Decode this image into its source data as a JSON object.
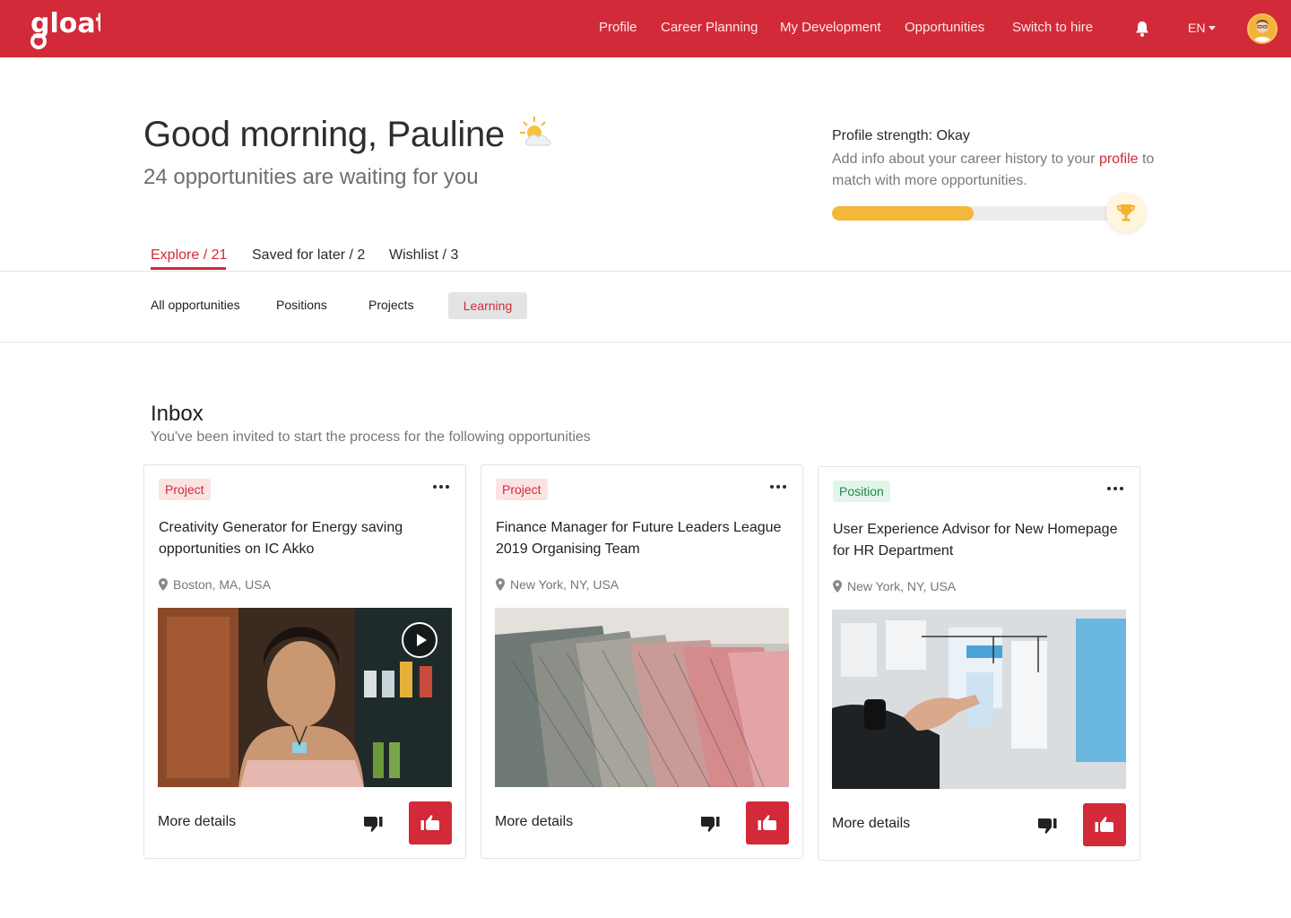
{
  "header": {
    "logo_text": "gloat",
    "nav": [
      "Profile",
      "Career Planning",
      "My Development",
      "Opportunities",
      "Switch to hire"
    ],
    "language": "EN",
    "brand_color": "#d22a38"
  },
  "greeting": {
    "title": "Good morning, Pauline",
    "subtitle": "24 opportunities are waiting for you",
    "weather_icon": "sun-cloud-icon"
  },
  "profile_strength": {
    "title": "Profile strength: Okay",
    "text_before": "Add info about your career history to your ",
    "link": "profile",
    "text_after": " to match with more opportunities.",
    "progress_fraction": 0.5,
    "bar_color": "#f3b73a"
  },
  "tabs": [
    "Explore / 21",
    "Saved for later / 2",
    "Wishlist / 3"
  ],
  "filters": [
    "All opportunities",
    "Positions",
    "Projects",
    "Learning"
  ],
  "inbox": {
    "title": "Inbox",
    "subtitle": "You've been invited to start the process for the following opportunities"
  },
  "cards": [
    {
      "badge": "Project",
      "title": "Creativity Generator for Energy saving opportunities on IC Akko",
      "location": "Boston, MA, USA",
      "more_details": "More details"
    },
    {
      "badge": "Project",
      "title": "Finance Manager for Future Leaders League 2019 Organising Team",
      "location": "New York, NY, USA",
      "more_details": "More details"
    },
    {
      "badge": "Position",
      "title": "User Experience Advisor for New Homepage for HR Department",
      "location": "New York, NY, USA",
      "more_details": "More details"
    }
  ]
}
